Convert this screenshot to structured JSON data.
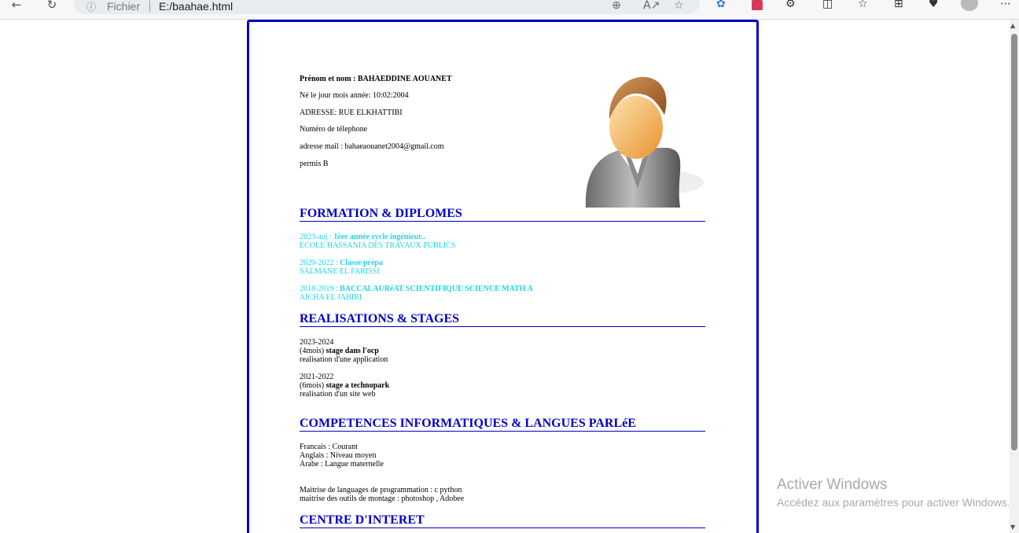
{
  "browser": {
    "scheme_label": "Fichier",
    "url": "E:/baahae.html",
    "icons": [
      "back-arrow-icon",
      "refresh-icon",
      "info-icon",
      "zoom-icon",
      "read-aloud-icon",
      "favorite-star-icon",
      "extension-icon",
      "translate-icon",
      "puzzle-icon",
      "split-screen-icon",
      "favorites-list-icon",
      "collections-icon",
      "browser-essentials-icon",
      "profile-icon",
      "more-icon"
    ]
  },
  "cv": {
    "identity": {
      "name_label": "Prénom et nom :",
      "name_value": "BAHAEDDINE AOUANET",
      "birth": "Né le jour mois année: 10:02:2004",
      "address": "ADRESSE: RUE ELKHATTIBI",
      "phone": "Numéro de télephone",
      "email": "adresse mail : bahaeaouanet2004@gmail.com",
      "license": "permis B"
    },
    "sections": {
      "formation": "FORMATION & DIPLOMES",
      "realisations": "REALISATIONS & STAGES",
      "competences": "COMPETENCES INFORMATIQUES & LANGUES PARLéE",
      "interets": "CENTRE D'INTERET"
    },
    "formation": [
      {
        "period": "2023-auj :",
        "title": "1ère année cycle ingénieur..",
        "school": "ECOLE HASSANIA DES TRAVAUX PUBLICS"
      },
      {
        "period": "2020-2022 :",
        "title": "Classe prépa",
        "school": "SALMANE EL FARISSI"
      },
      {
        "period": "2018-2019 :",
        "title": "BACCALAURéAT SCIENTIFIQUE SCIENCE MATH A",
        "school": "AICHA EL JABIRI"
      }
    ],
    "stages": [
      {
        "period": "2023-2024",
        "duration": "(4mois)",
        "title": "stage dans l'ocp",
        "desc": "realisation d'une application"
      },
      {
        "period": "2021-2022",
        "duration": "(6mois)",
        "title": "stage a technopark",
        "desc": "realisation d'un site web"
      }
    ],
    "langues": [
      "Francais : Courant",
      "Anglais : Niveau moyen",
      "Arabe : Langue maternelle"
    ],
    "informatique": [
      "Maitrise de languages de programmation : c python",
      "maitrise des outils de montage : photoshop , Adobee"
    ]
  },
  "watermark": {
    "title": "Activer Windows",
    "subtitle": "Accédez aux paramètres pour activer Windows."
  },
  "colors": {
    "accent_blue": "#0000cc",
    "cyan_text": "#19d9e6"
  }
}
